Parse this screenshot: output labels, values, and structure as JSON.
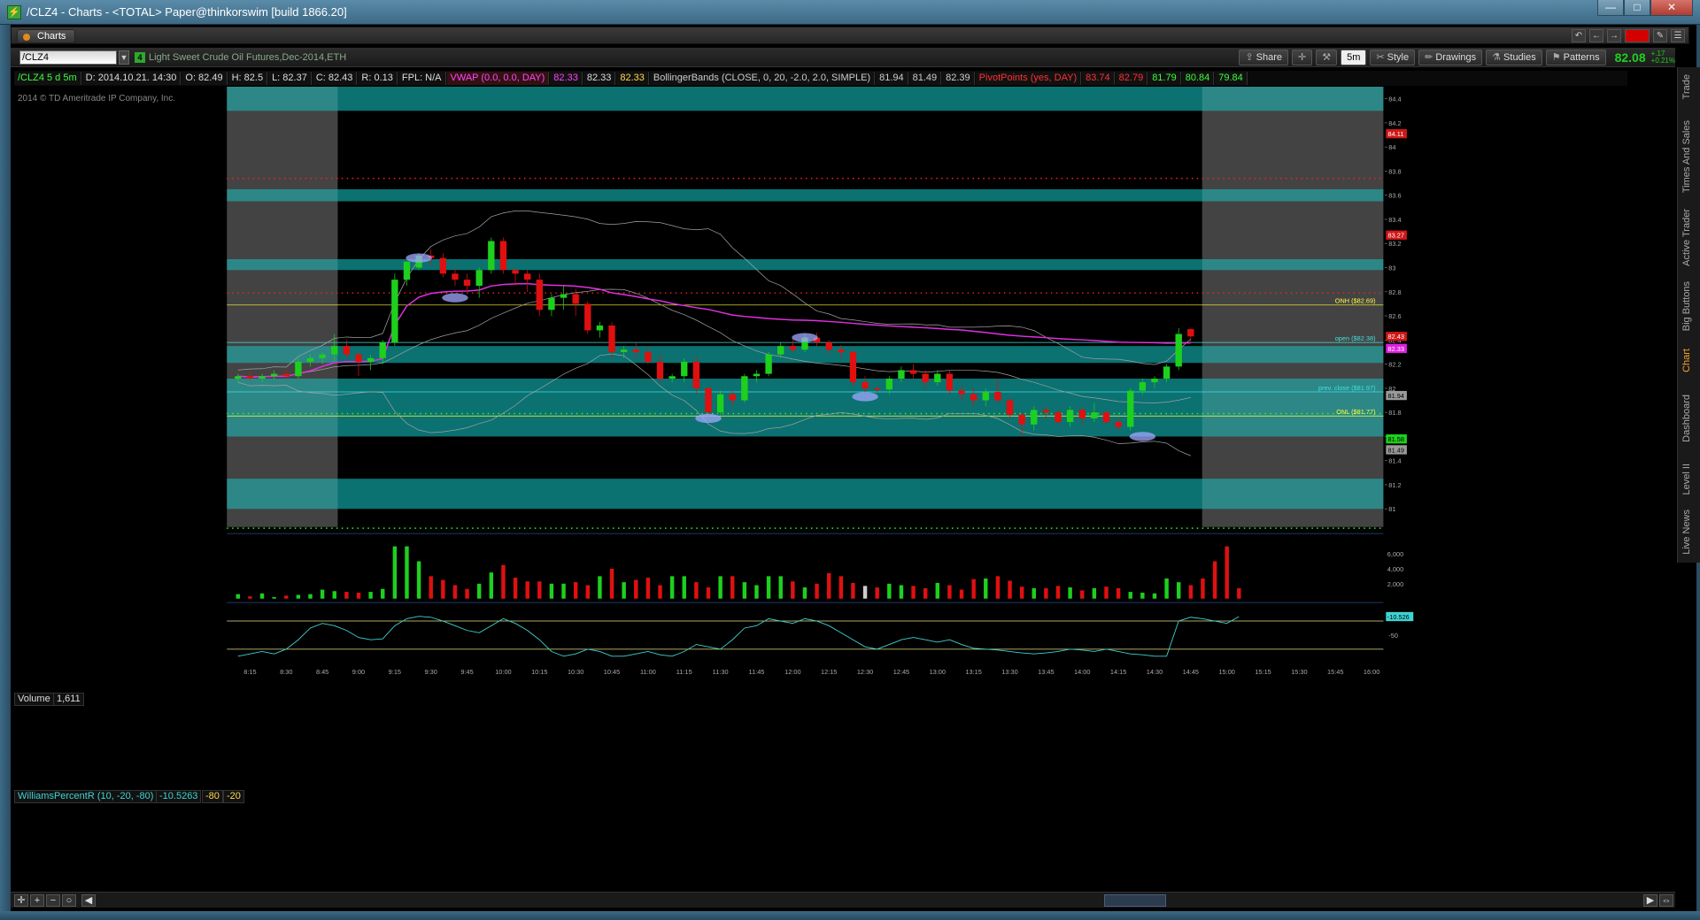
{
  "window": {
    "title": "/CLZ4 - Charts - <TOTAL> Paper@thinkorswim [build 1866.20]",
    "controls": [
      "—",
      "□",
      "✕"
    ]
  },
  "tabbar": {
    "tab_label": "Charts"
  },
  "toolbar": {
    "symbol": "/CLZ4",
    "badge": "4",
    "description": "Light Sweet Crude Oil Futures,Dec-2014,ETH",
    "share_label": "Share",
    "timeframe": "5m",
    "style_label": "Style",
    "drawings_label": "Drawings",
    "studies_label": "Studies",
    "patterns_label": "Patterns",
    "last_price": "82.08",
    "change_abs": "+.17",
    "change_pct": "+0.21%"
  },
  "infobar": {
    "symbol_period": "/CLZ4 5 d 5m",
    "date": "D: 2014.10.21. 14:30",
    "open": "O: 82.49",
    "high": "H: 82.5",
    "low": "L: 82.37",
    "close": "C: 82.43",
    "range": "R: 0.13",
    "fpl": "FPL: N/A",
    "vwap_label": "VWAP (0.0, 0.0, DAY)",
    "vwap_v1": "82.33",
    "vwap_v2": "82.33",
    "vwap_v3": "82.33",
    "bb_label": "BollingerBands (CLOSE, 0, 20, -2.0, 2.0, SIMPLE)",
    "bb_v1": "81.94",
    "bb_v2": "81.49",
    "bb_v3": "82.39",
    "pp_label": "PivotPoints (yes, DAY)",
    "pp_v1": "83.74",
    "pp_v2": "82.79",
    "pp_v3": "81.79",
    "pp_v4": "80.84",
    "pp_v5": "79.84"
  },
  "copyright": "2014 © TD Ameritrade IP Company, Inc.",
  "side_tabs": [
    "Trade",
    "Times And Sales",
    "Active Trader",
    "Big Buttons",
    "Chart",
    "Dashboard",
    "Level II",
    "Live News"
  ],
  "volume_panel": {
    "label": "Volume",
    "value": "1,611",
    "ticks": [
      "6,000",
      "4,000",
      "2,000"
    ]
  },
  "wpr_panel": {
    "label": "WilliamsPercentR (10, -20, -80)",
    "value": "-10.5263",
    "lvl1": "-80",
    "lvl2": "-20",
    "badge": "-10.526",
    "tick": "-50"
  },
  "price_axis": {
    "ticks": [
      "84.4",
      "84.2",
      "84",
      "83.8",
      "83.6",
      "83.4",
      "83.2",
      "83",
      "82.8",
      "82.6",
      "82.4",
      "82.2",
      "82",
      "81.8",
      "81.6",
      "81.4",
      "81.2",
      "81"
    ],
    "badges": [
      {
        "text": "84.11",
        "price": 84.11,
        "bg": "#d01818",
        "fg": "#ffffff"
      },
      {
        "text": "83.27",
        "price": 83.27,
        "bg": "#d01818",
        "fg": "#ffffff"
      },
      {
        "text": "82.43",
        "price": 82.43,
        "bg": "#d01818",
        "fg": "#ffffff"
      },
      {
        "text": "82.33",
        "price": 82.33,
        "bg": "#e020e0",
        "fg": "#ffffff"
      },
      {
        "text": "81.94",
        "price": 81.94,
        "bg": "#9a9a9a",
        "fg": "#000000"
      },
      {
        "text": "81.58",
        "price": 81.58,
        "bg": "#1ed01e",
        "fg": "#000000"
      },
      {
        "text": "81.49",
        "price": 81.49,
        "bg": "#9a9a9a",
        "fg": "#000000"
      }
    ]
  },
  "level_labels": [
    {
      "text": "ONH ($82.69)",
      "price": 82.69,
      "color": "#ffff40"
    },
    {
      "text": "open ($82.38)",
      "price": 82.38,
      "color": "#40e0e0"
    },
    {
      "text": "prev. close ($81.97)",
      "price": 81.97,
      "color": "#40e0e0"
    },
    {
      "text": "ONL ($81.77)",
      "price": 81.77,
      "color": "#ffff40"
    }
  ],
  "time_axis": [
    "8:15",
    "8:30",
    "8:45",
    "9:00",
    "9:15",
    "9:30",
    "9:45",
    "10:00",
    "10:15",
    "10:30",
    "10:45",
    "11:00",
    "11:15",
    "11:30",
    "11:45",
    "12:00",
    "12:15",
    "12:30",
    "12:45",
    "13:00",
    "13:15",
    "13:30",
    "13:45",
    "14:00",
    "14:15",
    "14:30",
    "14:45",
    "15:00",
    "15:15",
    "15:30",
    "15:45",
    "16:00"
  ],
  "colors": {
    "up": "#1ed01e",
    "down": "#e01010",
    "zone": "#0d8585",
    "vwap": "#e030e0",
    "bb": "#a0a0a0",
    "pivot_red": "#ff2020",
    "pivot_green": "#20ff20"
  },
  "chart_data": {
    "type": "candlestick",
    "symbol": "/CLZ4",
    "interval": "5m",
    "ylim": [
      80.85,
      84.5
    ],
    "bars": [
      {
        "t": "8:10",
        "o": 82.08,
        "h": 82.12,
        "l": 82.05,
        "c": 82.1
      },
      {
        "t": "8:15",
        "o": 82.1,
        "h": 82.14,
        "l": 82.07,
        "c": 82.08
      },
      {
        "t": "8:20",
        "o": 82.08,
        "h": 82.12,
        "l": 82.05,
        "c": 82.1
      },
      {
        "t": "8:25",
        "o": 82.1,
        "h": 82.15,
        "l": 82.07,
        "c": 82.12
      },
      {
        "t": "8:30",
        "o": 82.12,
        "h": 82.15,
        "l": 82.08,
        "c": 82.1
      },
      {
        "t": "8:35",
        "o": 82.1,
        "h": 82.25,
        "l": 82.08,
        "c": 82.22
      },
      {
        "t": "8:40",
        "o": 82.22,
        "h": 82.28,
        "l": 82.18,
        "c": 82.25
      },
      {
        "t": "8:45",
        "o": 82.25,
        "h": 82.3,
        "l": 82.2,
        "c": 82.28
      },
      {
        "t": "8:50",
        "o": 82.28,
        "h": 82.45,
        "l": 82.22,
        "c": 82.35
      },
      {
        "t": "8:55",
        "o": 82.35,
        "h": 82.4,
        "l": 82.25,
        "c": 82.28
      },
      {
        "t": "9:00",
        "o": 82.28,
        "h": 82.3,
        "l": 82.1,
        "c": 82.22
      },
      {
        "t": "9:05",
        "o": 82.22,
        "h": 82.28,
        "l": 82.15,
        "c": 82.25
      },
      {
        "t": "9:10",
        "o": 82.25,
        "h": 82.4,
        "l": 82.2,
        "c": 82.38
      },
      {
        "t": "9:15",
        "o": 82.38,
        "h": 82.95,
        "l": 82.35,
        "c": 82.9
      },
      {
        "t": "9:20",
        "o": 82.9,
        "h": 83.05,
        "l": 82.85,
        "c": 83.05
      },
      {
        "t": "9:25",
        "o": 83.0,
        "h": 83.12,
        "l": 82.98,
        "c": 83.1
      },
      {
        "t": "9:30",
        "o": 83.1,
        "h": 83.15,
        "l": 83.02,
        "c": 83.08
      },
      {
        "t": "9:35",
        "o": 83.08,
        "h": 83.12,
        "l": 82.92,
        "c": 82.95
      },
      {
        "t": "9:40",
        "o": 82.95,
        "h": 83.0,
        "l": 82.85,
        "c": 82.9
      },
      {
        "t": "9:45",
        "o": 82.9,
        "h": 82.95,
        "l": 82.8,
        "c": 82.85
      },
      {
        "t": "9:50",
        "o": 82.85,
        "h": 83.0,
        "l": 82.75,
        "c": 82.98
      },
      {
        "t": "9:55",
        "o": 82.98,
        "h": 83.25,
        "l": 82.95,
        "c": 83.22
      },
      {
        "t": "10:00",
        "o": 83.22,
        "h": 83.25,
        "l": 82.95,
        "c": 82.98
      },
      {
        "t": "10:05",
        "o": 82.98,
        "h": 83.0,
        "l": 82.85,
        "c": 82.95
      },
      {
        "t": "10:10",
        "o": 82.95,
        "h": 82.98,
        "l": 82.8,
        "c": 82.9
      },
      {
        "t": "10:15",
        "o": 82.9,
        "h": 82.95,
        "l": 82.6,
        "c": 82.65
      },
      {
        "t": "10:20",
        "o": 82.65,
        "h": 82.78,
        "l": 82.6,
        "c": 82.75
      },
      {
        "t": "10:25",
        "o": 82.75,
        "h": 82.85,
        "l": 82.65,
        "c": 82.78
      },
      {
        "t": "10:30",
        "o": 82.78,
        "h": 82.82,
        "l": 82.6,
        "c": 82.7
      },
      {
        "t": "10:35",
        "o": 82.7,
        "h": 82.72,
        "l": 82.45,
        "c": 82.48
      },
      {
        "t": "10:40",
        "o": 82.48,
        "h": 82.55,
        "l": 82.42,
        "c": 82.52
      },
      {
        "t": "10:45",
        "o": 82.52,
        "h": 82.55,
        "l": 82.25,
        "c": 82.3
      },
      {
        "t": "10:50",
        "o": 82.3,
        "h": 82.35,
        "l": 82.25,
        "c": 82.32
      },
      {
        "t": "10:55",
        "o": 82.32,
        "h": 82.38,
        "l": 82.25,
        "c": 82.3
      },
      {
        "t": "11:00",
        "o": 82.3,
        "h": 82.35,
        "l": 82.2,
        "c": 82.22
      },
      {
        "t": "11:05",
        "o": 82.22,
        "h": 82.28,
        "l": 82.05,
        "c": 82.08
      },
      {
        "t": "11:10",
        "o": 82.08,
        "h": 82.12,
        "l": 82.05,
        "c": 82.1
      },
      {
        "t": "11:15",
        "o": 82.1,
        "h": 82.25,
        "l": 82.05,
        "c": 82.22
      },
      {
        "t": "11:20",
        "o": 82.22,
        "h": 82.26,
        "l": 81.95,
        "c": 82.0
      },
      {
        "t": "11:25",
        "o": 82.0,
        "h": 82.02,
        "l": 81.75,
        "c": 81.8
      },
      {
        "t": "11:30",
        "o": 81.8,
        "h": 81.98,
        "l": 81.78,
        "c": 81.95
      },
      {
        "t": "11:35",
        "o": 81.95,
        "h": 81.98,
        "l": 81.85,
        "c": 81.9
      },
      {
        "t": "11:40",
        "o": 81.9,
        "h": 82.12,
        "l": 81.88,
        "c": 82.1
      },
      {
        "t": "11:45",
        "o": 82.1,
        "h": 82.15,
        "l": 82.05,
        "c": 82.12
      },
      {
        "t": "11:50",
        "o": 82.12,
        "h": 82.3,
        "l": 82.1,
        "c": 82.28
      },
      {
        "t": "11:55",
        "o": 82.28,
        "h": 82.38,
        "l": 82.25,
        "c": 82.35
      },
      {
        "t": "12:00",
        "o": 82.35,
        "h": 82.4,
        "l": 82.3,
        "c": 82.32
      },
      {
        "t": "12:05",
        "o": 82.32,
        "h": 82.45,
        "l": 82.3,
        "c": 82.42
      },
      {
        "t": "12:10",
        "o": 82.42,
        "h": 82.46,
        "l": 82.35,
        "c": 82.38
      },
      {
        "t": "12:15",
        "o": 82.38,
        "h": 82.4,
        "l": 82.28,
        "c": 82.32
      },
      {
        "t": "12:20",
        "o": 82.32,
        "h": 82.36,
        "l": 82.25,
        "c": 82.3
      },
      {
        "t": "12:25",
        "o": 82.3,
        "h": 82.32,
        "l": 82.02,
        "c": 82.05
      },
      {
        "t": "12:30",
        "o": 82.05,
        "h": 82.1,
        "l": 81.95,
        "c": 82.0
      },
      {
        "t": "12:35",
        "o": 82.0,
        "h": 82.02,
        "l": 81.97,
        "c": 81.99
      },
      {
        "t": "12:40",
        "o": 81.99,
        "h": 82.1,
        "l": 81.95,
        "c": 82.08
      },
      {
        "t": "12:45",
        "o": 82.08,
        "h": 82.18,
        "l": 82.05,
        "c": 82.15
      },
      {
        "t": "12:50",
        "o": 82.15,
        "h": 82.2,
        "l": 82.08,
        "c": 82.12
      },
      {
        "t": "12:55",
        "o": 82.12,
        "h": 82.15,
        "l": 82.0,
        "c": 82.05
      },
      {
        "t": "13:00",
        "o": 82.05,
        "h": 82.15,
        "l": 82.02,
        "c": 82.12
      },
      {
        "t": "13:05",
        "o": 82.12,
        "h": 82.15,
        "l": 81.95,
        "c": 81.98
      },
      {
        "t": "13:10",
        "o": 81.98,
        "h": 82.02,
        "l": 81.9,
        "c": 81.95
      },
      {
        "t": "13:15",
        "o": 81.95,
        "h": 82.0,
        "l": 81.85,
        "c": 81.9
      },
      {
        "t": "13:20",
        "o": 81.9,
        "h": 82.0,
        "l": 81.85,
        "c": 81.97
      },
      {
        "t": "13:25",
        "o": 81.97,
        "h": 82.08,
        "l": 81.88,
        "c": 81.9
      },
      {
        "t": "13:30",
        "o": 81.9,
        "h": 81.92,
        "l": 81.75,
        "c": 81.78
      },
      {
        "t": "13:35",
        "o": 81.78,
        "h": 81.8,
        "l": 81.6,
        "c": 81.7
      },
      {
        "t": "13:40",
        "o": 81.7,
        "h": 81.85,
        "l": 81.65,
        "c": 81.82
      },
      {
        "t": "13:45",
        "o": 81.82,
        "h": 81.85,
        "l": 81.75,
        "c": 81.8
      },
      {
        "t": "13:50",
        "o": 81.8,
        "h": 81.82,
        "l": 81.7,
        "c": 81.72
      },
      {
        "t": "13:55",
        "o": 81.72,
        "h": 81.85,
        "l": 81.68,
        "c": 81.82
      },
      {
        "t": "14:00",
        "o": 81.82,
        "h": 81.85,
        "l": 81.7,
        "c": 81.75
      },
      {
        "t": "14:05",
        "o": 81.75,
        "h": 81.88,
        "l": 81.72,
        "c": 81.8
      },
      {
        "t": "14:10",
        "o": 81.8,
        "h": 81.82,
        "l": 81.7,
        "c": 81.72
      },
      {
        "t": "14:15",
        "o": 81.72,
        "h": 81.75,
        "l": 81.65,
        "c": 81.68
      },
      {
        "t": "14:20",
        "o": 81.68,
        "h": 82.0,
        "l": 81.65,
        "c": 81.98
      },
      {
        "t": "14:25",
        "o": 81.98,
        "h": 82.08,
        "l": 81.95,
        "c": 82.05
      },
      {
        "t": "14:30",
        "o": 82.05,
        "h": 82.1,
        "l": 82.0,
        "c": 82.08
      },
      {
        "t": "14:35",
        "o": 82.08,
        "h": 82.2,
        "l": 82.05,
        "c": 82.18
      },
      {
        "t": "14:40",
        "o": 82.18,
        "h": 82.5,
        "l": 82.15,
        "c": 82.45
      },
      {
        "t": "14:45",
        "o": 82.49,
        "h": 82.5,
        "l": 82.37,
        "c": 82.43
      }
    ],
    "volume": [
      600,
      300,
      700,
      200,
      400,
      500,
      600,
      1200,
      1000,
      900,
      800,
      900,
      1300,
      7000,
      7000,
      5000,
      3000,
      2500,
      1800,
      1300,
      2000,
      3500,
      4500,
      2800,
      2300,
      2300,
      2000,
      2000,
      2200,
      1800,
      3000,
      4000,
      2200,
      2500,
      2800,
      1800,
      3000,
      3000,
      2200,
      1500,
      3000,
      3000,
      2200,
      1800,
      3000,
      3000,
      2300,
      1500,
      2000,
      3400,
      3000,
      2100,
      1700,
      1500,
      2000,
      1800,
      1700,
      1400,
      2100,
      1800,
      1200,
      2600,
      2700,
      3000,
      2400,
      1600,
      1400,
      1400,
      1700,
      1500,
      1100,
      1400,
      1600,
      1400,
      900,
      800,
      700,
      2700,
      2200,
      1800,
      2700,
      5000,
      7000,
      1400
    ],
    "wpr": [
      -95,
      -90,
      -85,
      -90,
      -80,
      -60,
      -35,
      -25,
      -30,
      -40,
      -55,
      -60,
      -58,
      -30,
      -15,
      -10,
      -12,
      -20,
      -30,
      -40,
      -45,
      -30,
      -15,
      -25,
      -40,
      -60,
      -85,
      -95,
      -90,
      -80,
      -85,
      -95,
      -95,
      -90,
      -85,
      -92,
      -95,
      -85,
      -70,
      -75,
      -80,
      -60,
      -35,
      -30,
      -15,
      -20,
      -25,
      -15,
      -20,
      -30,
      -45,
      -60,
      -75,
      -80,
      -70,
      -60,
      -55,
      -60,
      -65,
      -60,
      -70,
      -78,
      -80,
      -82,
      -85,
      -88,
      -90,
      -88,
      -85,
      -80,
      -82,
      -85,
      -80,
      -85,
      -90,
      -92,
      -95,
      -95,
      -20,
      -12,
      -15,
      -20,
      -25,
      -10.5
    ]
  }
}
